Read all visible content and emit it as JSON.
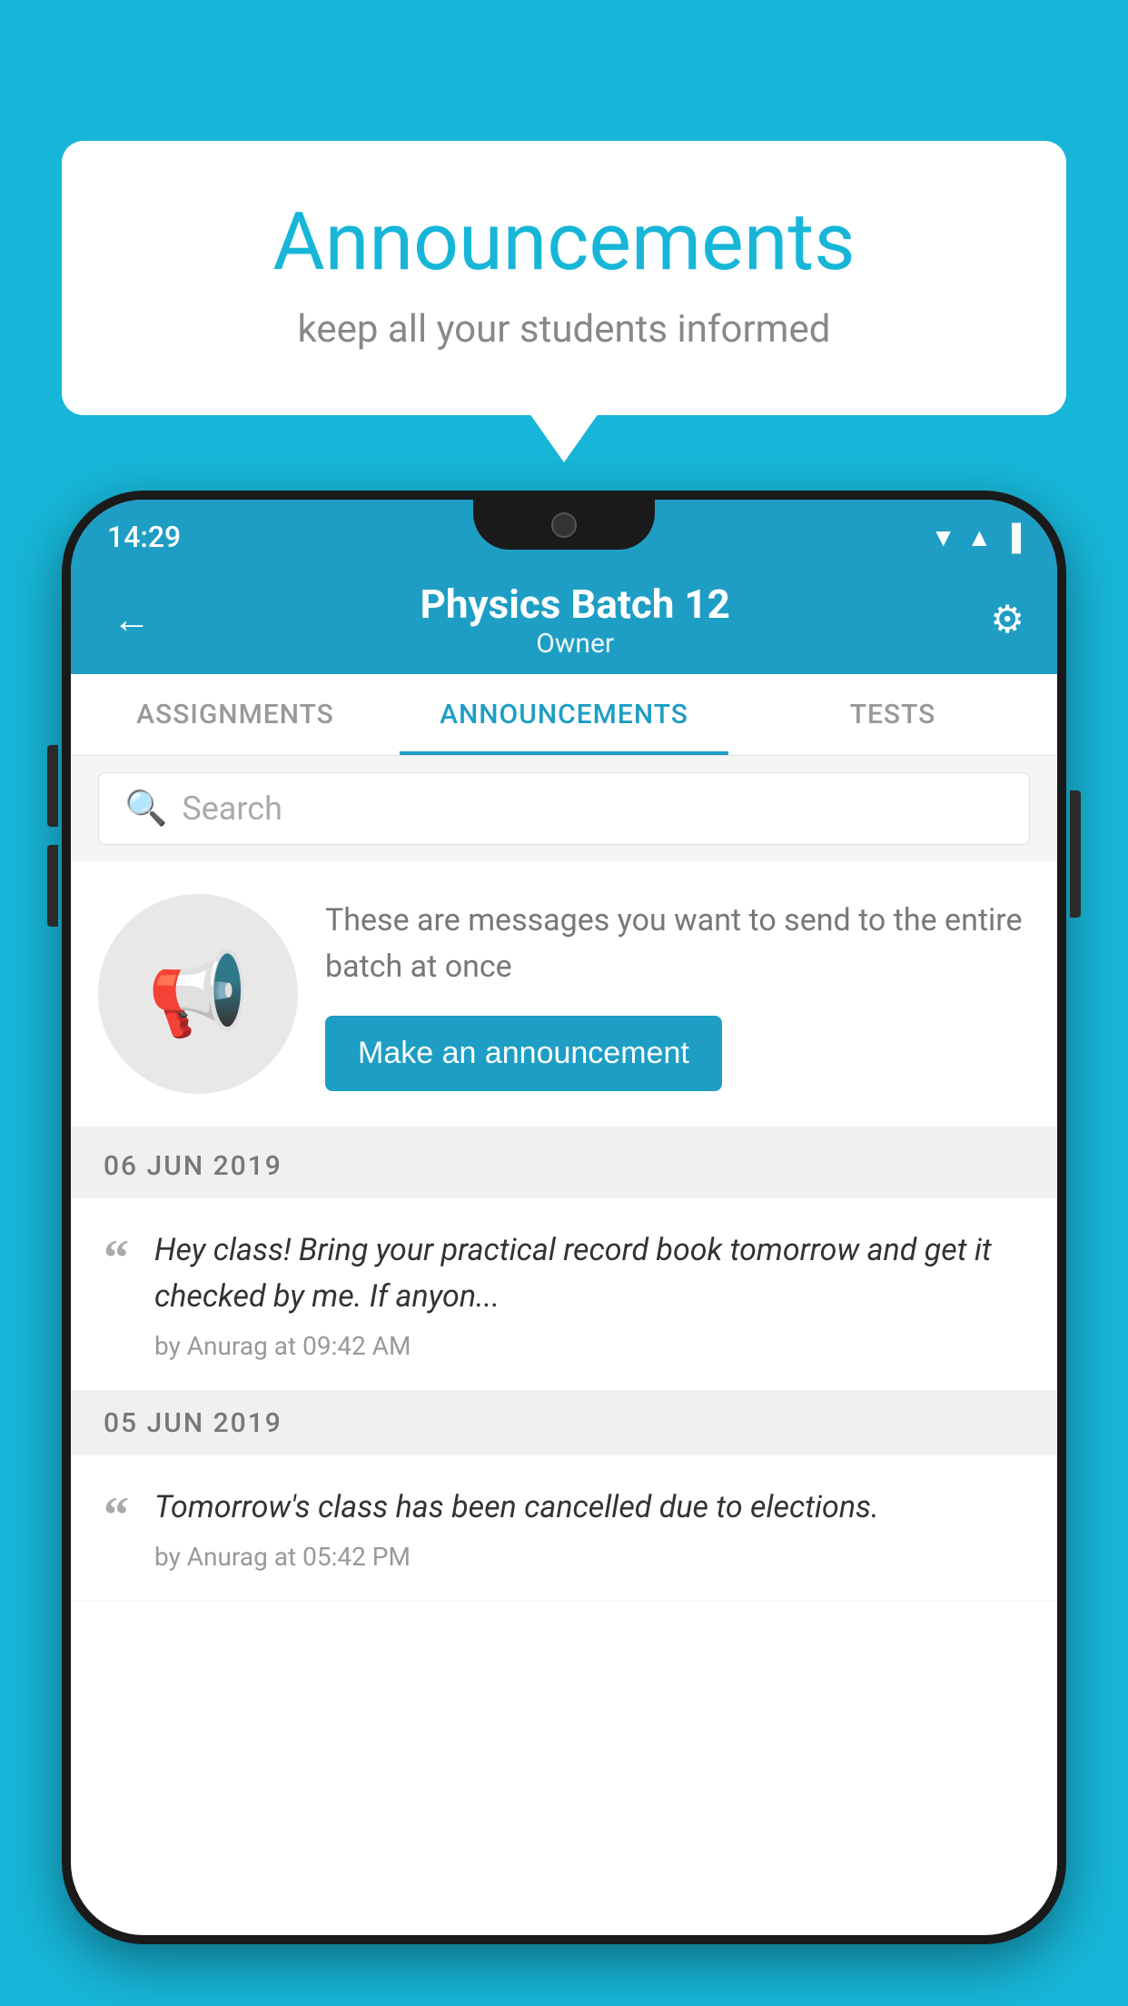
{
  "background_color": "#17b6d8",
  "speech_bubble": {
    "title": "Announcements",
    "subtitle": "keep all your students informed"
  },
  "phone": {
    "status_bar": {
      "time": "14:29",
      "icons": [
        "▼",
        "▲",
        "▐"
      ]
    },
    "header": {
      "title": "Physics Batch 12",
      "subtitle": "Owner",
      "back_label": "←",
      "settings_label": "⚙"
    },
    "tabs": [
      {
        "label": "ASSIGNMENTS",
        "active": false
      },
      {
        "label": "ANNOUNCEMENTS",
        "active": true
      },
      {
        "label": "TESTS",
        "active": false
      }
    ],
    "search": {
      "placeholder": "Search"
    },
    "announcement_promo": {
      "description": "These are messages you want to send to the entire batch at once",
      "button_label": "Make an announcement"
    },
    "announcements": [
      {
        "date": "06  JUN  2019",
        "text": "Hey class! Bring your practical record book tomorrow and get it checked by me. If anyon...",
        "meta": "by Anurag at 09:42 AM"
      },
      {
        "date": "05  JUN  2019",
        "text": "Tomorrow's class has been cancelled due to elections.",
        "meta": "by Anurag at 05:42 PM"
      }
    ]
  }
}
